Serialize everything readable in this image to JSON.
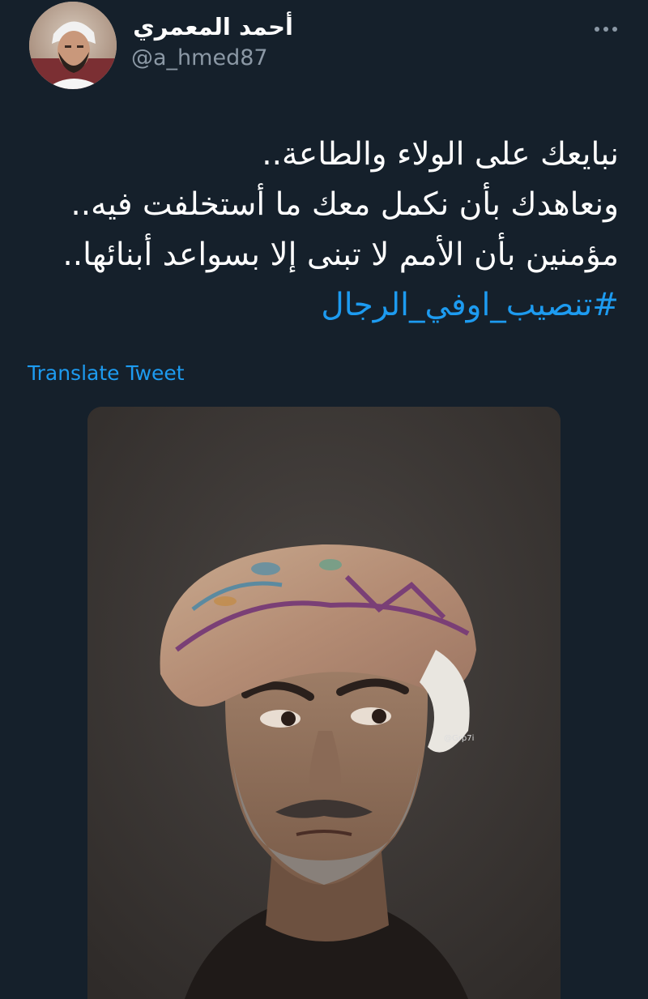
{
  "tweet": {
    "author": {
      "display_name": "أحمد المعمري",
      "handle": "@a_hmed87"
    },
    "more_icon": "more-horizontal-icon",
    "text_lines": [
      "نبايعك على الولاء والطاعة..",
      "ونعاهدك بأن نكمل معك ما أستخلفت فيه..",
      "مؤمنين بأن الأمم لا تبنى إلا بسواعد أبنائها.."
    ],
    "hashtag": "#تنصيب_اوفي_الرجال",
    "translate_label": "Translate Tweet",
    "media": {
      "watermark": "@Grp7i"
    }
  },
  "colors": {
    "background": "#15202b",
    "text": "#ffffff",
    "secondary": "#8b98a5",
    "link": "#1d9bf0"
  }
}
